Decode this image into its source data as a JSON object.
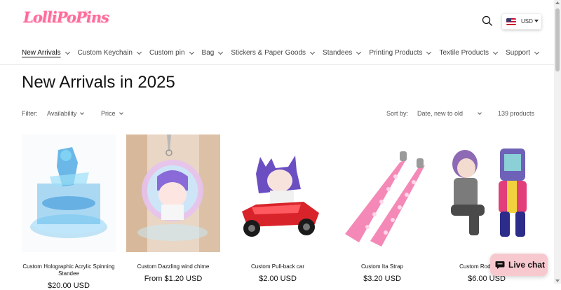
{
  "brand": {
    "logo_text": "LolliPoPins",
    "registered_mark": "®"
  },
  "header": {
    "search_icon": "search-icon",
    "currency": {
      "label": "USD",
      "flag": "us-flag-icon"
    }
  },
  "nav": {
    "items": [
      {
        "label": "New Arrivals",
        "active": true
      },
      {
        "label": "Custom Keychain"
      },
      {
        "label": "Custom pin"
      },
      {
        "label": "Bag"
      },
      {
        "label": "Stickers & Paper Goods"
      },
      {
        "label": "Standees"
      },
      {
        "label": "Printing Products"
      },
      {
        "label": "Textile Products"
      },
      {
        "label": "Support"
      }
    ]
  },
  "page": {
    "title": "New Arrivals in 2025"
  },
  "filters": {
    "label": "Filter:",
    "availability": "Availability",
    "price": "Price",
    "sort_label": "Sort by:",
    "sort_value": "Date, new to old",
    "count": "139 products"
  },
  "products": [
    {
      "title": "Custom Holographic Acrylic Spinning Standee",
      "price": "$20.00 USD"
    },
    {
      "title": "Custom Dazzling wind chime",
      "price": "From $1.20 USD"
    },
    {
      "title": "Custom Pull-back car",
      "price": "$2.00 USD"
    },
    {
      "title": "Custom Ita Strap",
      "price": "$3.20 USD"
    },
    {
      "title": "Custom Rodent Plush",
      "price": "$6.00 USD"
    }
  ],
  "chat": {
    "label": "Live chat",
    "icon": "chat-bubble-icon"
  },
  "colors": {
    "brand_pink": "#ff6b9a",
    "chat_bg": "#f7c9cf"
  }
}
